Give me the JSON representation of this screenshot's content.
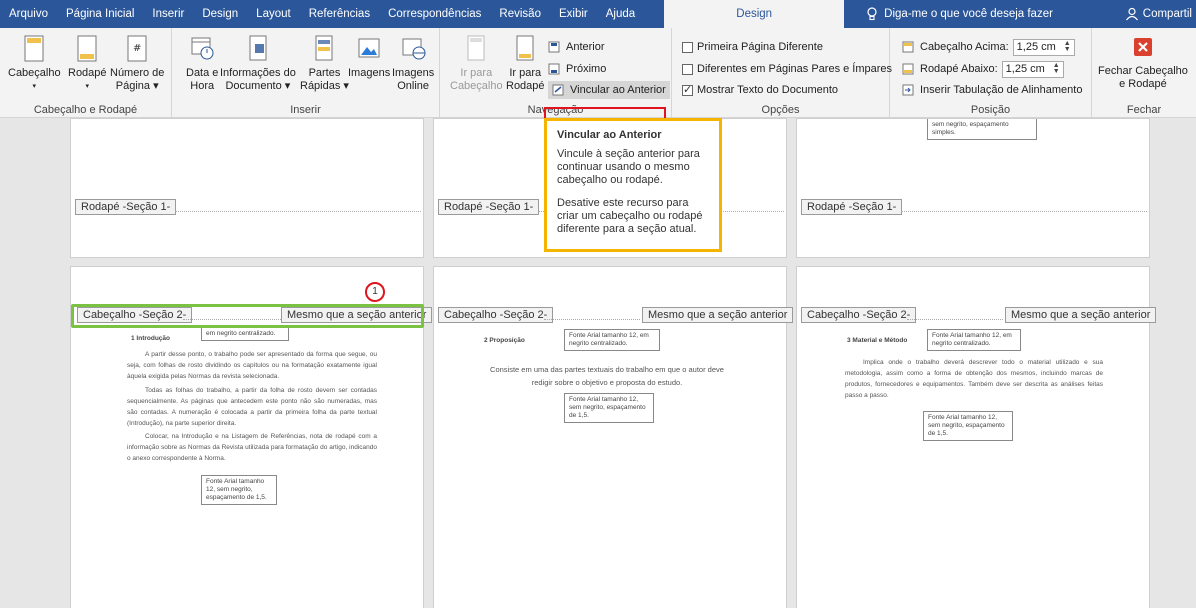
{
  "tabs": [
    "Arquivo",
    "Página Inicial",
    "Inserir",
    "Design",
    "Layout",
    "Referências",
    "Correspondências",
    "Revisão",
    "Exibir",
    "Ajuda"
  ],
  "active_tab": "Design",
  "tell_me": "Diga-me o que você deseja fazer",
  "share": "Compartil",
  "groups": {
    "hf": {
      "label": "Cabeçalho e Rodapé",
      "cabecalho": "Cabeçalho",
      "rodape": "Rodapé",
      "numero_l1": "Número de",
      "numero_l2": "Página"
    },
    "inserir": {
      "label": "Inserir",
      "data_l1": "Data e",
      "data_l2": "Hora",
      "info_l1": "Informações do",
      "info_l2": "Documento",
      "partes_l1": "Partes",
      "partes_l2": "Rápidas",
      "imagens": "Imagens",
      "imagens_online_l1": "Imagens",
      "imagens_online_l2": "Online"
    },
    "navegacao": {
      "label": "Navegação",
      "ir_cab_l1": "Ir para",
      "ir_cab_l2": "Cabeçalho",
      "ir_rod_l1": "Ir para",
      "ir_rod_l2": "Rodapé",
      "anterior": "Anterior",
      "proximo": "Próximo",
      "vincular": "Vincular ao Anterior"
    },
    "opcoes": {
      "label": "Opções",
      "primeira": "Primeira Página Diferente",
      "pares": "Diferentes em Páginas Pares e Ímpares",
      "mostrar": "Mostrar Texto do Documento"
    },
    "posicao": {
      "label": "Posição",
      "cab_acima": "Cabeçalho Acima:",
      "cab_acima_val": "1,25 cm",
      "rod_abaixo": "Rodapé Abaixo:",
      "rod_abaixo_val": "1,25 cm",
      "tabulacao": "Inserir Tabulação de Alinhamento"
    },
    "fechar": {
      "label": "Fechar",
      "btn_l1": "Fechar Cabeçalho",
      "btn_l2": "e Rodapé"
    }
  },
  "tooltip": {
    "title": "Vincular ao Anterior",
    "p1": "Vincule à seção anterior para continuar usando o mesmo cabeçalho ou rodapé.",
    "p2": "Desative este recurso para criar um cabeçalho ou rodapé diferente para a seção atual."
  },
  "doc": {
    "footer_tag": "Rodapé -Seção 1-",
    "header_tag": "Cabeçalho -Seção 2-",
    "same_tag": "Mesmo que a seção anterior",
    "top_note": "sem negrito, espaçamento simples.",
    "circle_num": "1",
    "page1": {
      "heading": "1 Introdução",
      "box1": "em negrito centralizado.",
      "p1": "A partir desse ponto, o trabalho pode ser apresentado da forma que segue, ou seja, com folhas de rosto dividindo os capítulos ou na formatação exatamente igual àquela exigida pelas Normas da revista selecionada.",
      "p2": "Todas as folhas do trabalho, a partir da folha de rosto devem ser contadas sequencialmente. As páginas que antecedem este ponto não são numeradas, mas são contadas. A numeração é colocada a partir da primeira folha da parte textual (Introdução), na parte superior direita.",
      "p3": "Colocar, na Introdução e na Listagem de Referências, nota de rodapé com a informação sobre as Normas da Revista utilizada para formatação do artigo, indicando o anexo correspondente à Norma.",
      "box2": "Fonte Arial tamanho 12, sem negrito, espaçamento de 1,5."
    },
    "page2": {
      "heading": "2 Proposição",
      "box1": "Fonte Arial tamanho 12, em negrito centralizado.",
      "p1": "Consiste em uma das partes textuais do trabalho em que o autor deve redigir sobre o objetivo e proposta do estudo.",
      "box2": "Fonte Arial tamanho 12, sem negrito, espaçamento de 1,5."
    },
    "page3": {
      "heading": "3 Material e Método",
      "box1": "Fonte Arial tamanho 12, em negrito centralizado.",
      "p1": "Implica onde o trabalho deverá descrever todo o material utilizado e sua metodologia, assim como a forma de obtenção dos mesmos, incluindo marcas de produtos, fornecedores e equipamentos. Também deve ser descrita as análises feitas passo a passo.",
      "box2": "Fonte Arial tamanho 12, sem negrito, espaçamento de 1,5."
    }
  },
  "colors": {
    "ribbon_blue": "#2b579a",
    "highlight_red": "#e0141e",
    "tooltip_border": "#f5b400",
    "green_box": "#7cc242",
    "close_red": "#d9412e"
  }
}
